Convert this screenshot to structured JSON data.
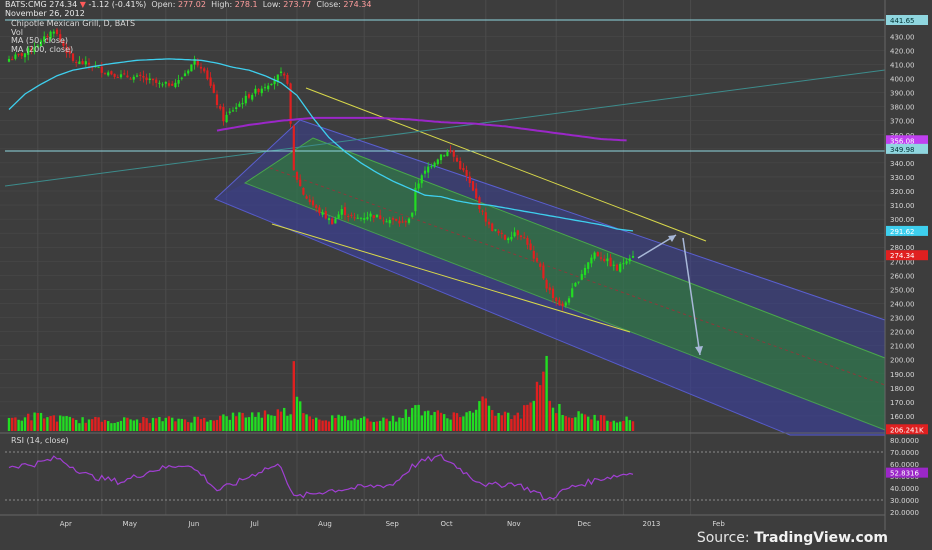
{
  "header": {
    "symbol": "BATS:CMG",
    "last": "274.34",
    "change": "-1.12 (-0.41%)",
    "open_label": "Open:",
    "open": "277.02",
    "high_label": "High:",
    "high": "278.1",
    "low_label": "Low:",
    "low": "273.77",
    "close_label": "Close:",
    "close": "274.34",
    "date": "November 26, 2012",
    "title": "Chipotle Mexican Grill, D, BATS"
  },
  "indicators": {
    "vol": "Vol",
    "ma50": "MA (50, close)",
    "ma200": "MA (200, close)",
    "rsi": "RSI (14, close)"
  },
  "footer": {
    "source_label": "Source:",
    "brand": "TradingView.com"
  },
  "colors": {
    "background": "#3d3d3d",
    "grid": "#4c4c4c",
    "up": "#22dd22",
    "down": "#e02020",
    "ma50": "#3ecfee",
    "ma200": "#9b27c8",
    "channel_outer": "#3a3f9e",
    "channel_inner": "#2e8a2e",
    "trendline": "#d8d84a",
    "rsi": "#a13fd3",
    "arrow": "#a8b8d8"
  },
  "chart_data": {
    "type": "candlestick",
    "x_labels": [
      "Apr",
      "May",
      "Jun",
      "Jul",
      "Aug",
      "Sep",
      "Oct",
      "Nov",
      "Dec",
      "2013",
      "Feb"
    ],
    "y_axis": {
      "ticks": [
        "430.00",
        "420.00",
        "410.00",
        "400.00",
        "390.00",
        "380.00",
        "370.00",
        "360.00",
        "350.00",
        "340.00",
        "330.00",
        "320.00",
        "310.00",
        "300.00",
        "290.00",
        "280.00",
        "270.00",
        "260.00",
        "250.00",
        "240.00",
        "230.00",
        "220.00",
        "210.00",
        "200.00",
        "190.00",
        "180.00",
        "170.00",
        "160.00",
        "150.00"
      ],
      "range": [
        150,
        441.65
      ]
    },
    "price_badges": [
      {
        "label": "441.65",
        "value": 441.65,
        "color": "#8fd6df"
      },
      {
        "label": "356.08",
        "value": 356.08,
        "color": "#c040f0"
      },
      {
        "label": "349.98",
        "value": 349.98,
        "color": "#8fd6df"
      },
      {
        "label": "291.62",
        "value": 291.62,
        "color": "#3ecfee"
      },
      {
        "label": "274.34",
        "value": 274.34,
        "color": "#e02020"
      },
      {
        "label": "206.241K",
        "value": 150.5,
        "color": "#e02020"
      }
    ],
    "rsi_axis": {
      "ticks": [
        "80.0000",
        "70.0000",
        "60.0000",
        "50.0000",
        "40.0000",
        "30.0000",
        "20.0000"
      ],
      "range": [
        17,
        83
      ],
      "levels": [
        70,
        30
      ],
      "current": "52.8316",
      "current_value": 52.8
    },
    "price_keypoints": [
      [
        0,
        414
      ],
      [
        5,
        418
      ],
      [
        10,
        426
      ],
      [
        14,
        435
      ],
      [
        20,
        412
      ],
      [
        25,
        410
      ],
      [
        30,
        405
      ],
      [
        35,
        402
      ],
      [
        42,
        400
      ],
      [
        48,
        395
      ],
      [
        53,
        398
      ],
      [
        58,
        413
      ],
      [
        61,
        407
      ],
      [
        64,
        388
      ],
      [
        67,
        371
      ],
      [
        70,
        378
      ],
      [
        75,
        388
      ],
      [
        80,
        395
      ],
      [
        85,
        403
      ],
      [
        87,
        398
      ],
      [
        89,
        334
      ],
      [
        92,
        318
      ],
      [
        96,
        307
      ],
      [
        101,
        298
      ],
      [
        104,
        306
      ],
      [
        108,
        300
      ],
      [
        113,
        303
      ],
      [
        118,
        300
      ],
      [
        123,
        297
      ],
      [
        126,
        303
      ],
      [
        127,
        323
      ],
      [
        131,
        337
      ],
      [
        135,
        346
      ],
      [
        138,
        348
      ],
      [
        143,
        330
      ],
      [
        147,
        309
      ],
      [
        150,
        295
      ],
      [
        155,
        286
      ],
      [
        158,
        291
      ],
      [
        160,
        289
      ],
      [
        162,
        283
      ],
      [
        164,
        271
      ],
      [
        166,
        265
      ],
      [
        168,
        252
      ],
      [
        171,
        242
      ],
      [
        173,
        237
      ],
      [
        176,
        249
      ],
      [
        180,
        266
      ],
      [
        183,
        276
      ],
      [
        187,
        270
      ],
      [
        190,
        264
      ],
      [
        193,
        272
      ],
      [
        195,
        275
      ]
    ],
    "ma50_keypoints": [
      [
        0,
        378
      ],
      [
        5,
        389
      ],
      [
        10,
        396
      ],
      [
        15,
        402
      ],
      [
        20,
        406
      ],
      [
        30,
        410
      ],
      [
        40,
        413
      ],
      [
        50,
        414
      ],
      [
        60,
        413
      ],
      [
        65,
        411
      ],
      [
        70,
        408
      ],
      [
        75,
        406
      ],
      [
        80,
        402
      ],
      [
        85,
        397
      ],
      [
        90,
        388
      ],
      [
        95,
        372
      ],
      [
        100,
        358
      ],
      [
        105,
        348
      ],
      [
        110,
        340
      ],
      [
        115,
        333
      ],
      [
        120,
        327
      ],
      [
        125,
        322
      ],
      [
        130,
        317
      ],
      [
        135,
        316
      ],
      [
        140,
        313
      ],
      [
        145,
        311
      ],
      [
        150,
        310
      ],
      [
        155,
        308
      ],
      [
        160,
        306
      ],
      [
        165,
        304
      ],
      [
        170,
        302
      ],
      [
        175,
        300
      ],
      [
        180,
        298
      ],
      [
        185,
        296
      ],
      [
        190,
        293
      ],
      [
        195,
        291.6
      ]
    ],
    "ma200_keypoints": [
      [
        65,
        363
      ],
      [
        75,
        367
      ],
      [
        85,
        370
      ],
      [
        95,
        372
      ],
      [
        105,
        372
      ],
      [
        115,
        372
      ],
      [
        125,
        371
      ],
      [
        135,
        369
      ],
      [
        145,
        368
      ],
      [
        155,
        366
      ],
      [
        165,
        363
      ],
      [
        175,
        360
      ],
      [
        185,
        357
      ],
      [
        193,
        356
      ]
    ],
    "volume_keypoints": [
      [
        0,
        1.1
      ],
      [
        10,
        1.4
      ],
      [
        20,
        1.0
      ],
      [
        40,
        1.0
      ],
      [
        60,
        1.1
      ],
      [
        80,
        1.6
      ],
      [
        88,
        1.8
      ],
      [
        89,
        9.0
      ],
      [
        90,
        2.6
      ],
      [
        92,
        2.2
      ],
      [
        95,
        1.2
      ],
      [
        120,
        1.1
      ],
      [
        126,
        1.8
      ],
      [
        127,
        2.2
      ],
      [
        135,
        1.4
      ],
      [
        145,
        1.6
      ],
      [
        150,
        3.0
      ],
      [
        151,
        1.6
      ],
      [
        160,
        1.3
      ],
      [
        168,
        6.3
      ],
      [
        169,
        2.5
      ],
      [
        175,
        1.5
      ],
      [
        185,
        1.2
      ],
      [
        195,
        1.0
      ]
    ],
    "rsi_keypoints": [
      [
        0,
        58
      ],
      [
        8,
        60
      ],
      [
        15,
        65
      ],
      [
        25,
        50
      ],
      [
        35,
        45
      ],
      [
        45,
        55
      ],
      [
        55,
        60
      ],
      [
        60,
        52
      ],
      [
        65,
        38
      ],
      [
        70,
        43
      ],
      [
        80,
        56
      ],
      [
        85,
        59
      ],
      [
        89,
        32
      ],
      [
        100,
        38
      ],
      [
        120,
        43
      ],
      [
        126,
        58
      ],
      [
        130,
        63
      ],
      [
        135,
        66
      ],
      [
        140,
        58
      ],
      [
        145,
        48
      ],
      [
        150,
        42
      ],
      [
        158,
        44
      ],
      [
        165,
        36
      ],
      [
        168,
        30
      ],
      [
        175,
        40
      ],
      [
        185,
        48
      ],
      [
        195,
        52.8
      ]
    ],
    "x_label_bars": [
      9,
      29,
      49,
      68,
      90,
      111,
      128,
      149,
      171,
      192,
      213
    ]
  }
}
